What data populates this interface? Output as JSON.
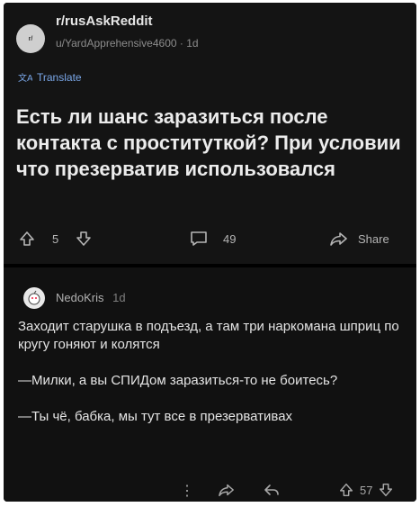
{
  "post": {
    "subreddit": "r/rusAskReddit",
    "meta": "u/YardApprehensive4600 · 1d",
    "translate_label": "Translate",
    "title": "Есть ли шанс заразиться после контакта с проституткой? При условии что презерватив использовался",
    "upvotes": "5",
    "comments": "49",
    "share_label": "Share"
  },
  "comment": {
    "author": "NedoKris",
    "age": "1d",
    "paragraphs": [
      "Заходит старушка в подъезд, а там три наркомана шприц по кругу гоняют и колятся",
      "—Милки, а вы СПИДом заразиться-то не боитесь?",
      "—Ты чё, бабка, мы тут все в презервативах"
    ],
    "score": "57",
    "more_label": "⋮"
  }
}
